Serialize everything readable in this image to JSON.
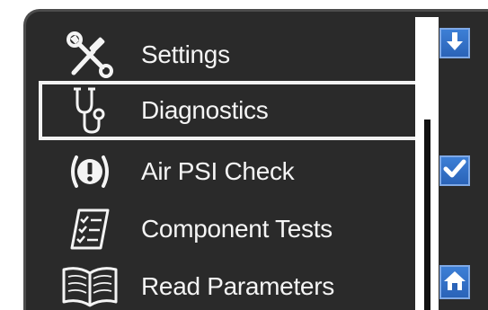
{
  "menu": {
    "items": [
      {
        "label": "Settings",
        "icon": "wrench-screwdriver-icon",
        "selected": false
      },
      {
        "label": "Diagnostics",
        "icon": "stethoscope-icon",
        "selected": true
      },
      {
        "label": "Air PSI Check",
        "icon": "alert-circle-icon",
        "selected": false
      },
      {
        "label": "Component Tests",
        "icon": "checklist-icon",
        "selected": false
      },
      {
        "label": "Read Parameters",
        "icon": "open-book-icon",
        "selected": false
      }
    ]
  },
  "side_buttons": [
    {
      "name": "scroll-down-button",
      "icon": "arrow-down-icon"
    },
    {
      "name": "confirm-button",
      "icon": "checkmark-icon"
    },
    {
      "name": "home-button",
      "icon": "home-icon"
    }
  ],
  "colors": {
    "screen_background": "#2a2a2a",
    "text": "#f4f4f4",
    "selection_border": "#f2f2f2",
    "button_blue": "#3d7fd6"
  }
}
